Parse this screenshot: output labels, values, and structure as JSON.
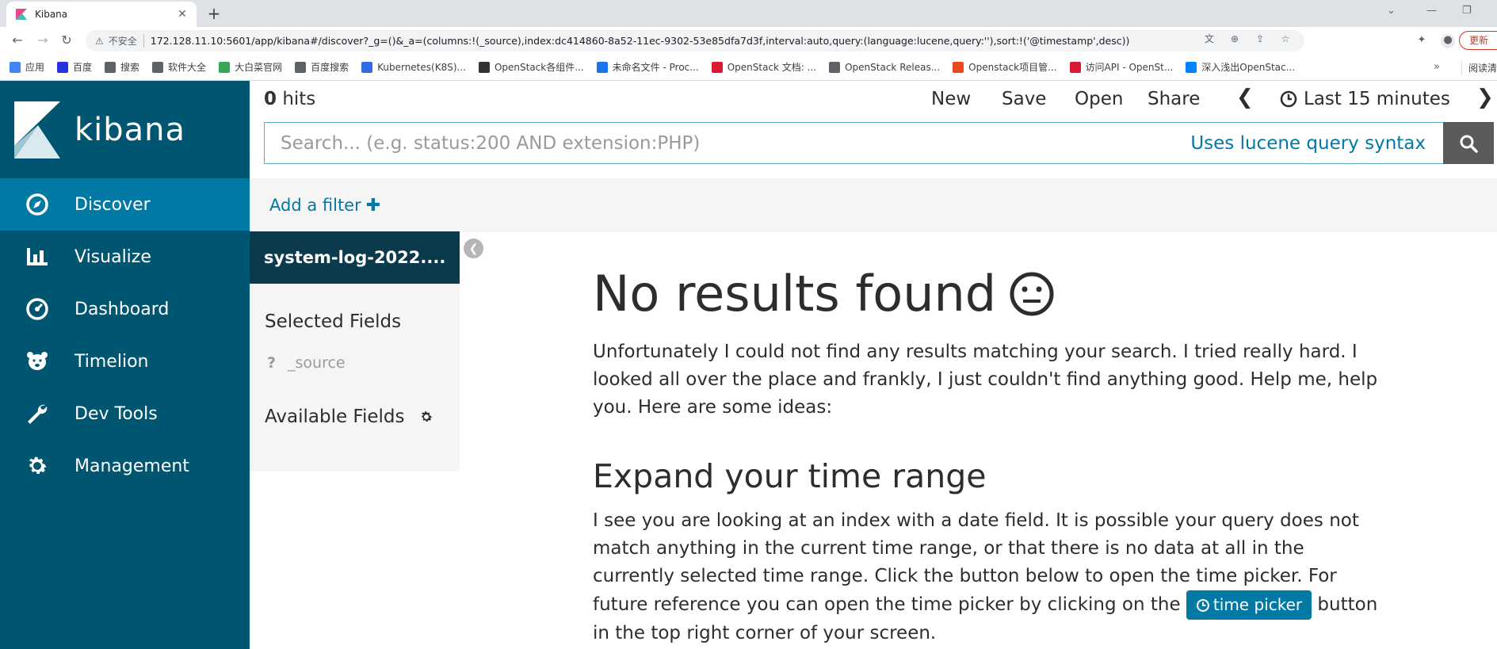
{
  "browser": {
    "tab_title": "Kibana",
    "insecure_label": "不安全",
    "url": "172.128.11.10:5601/app/kibana#/discover?_g=()&_a=(columns:!(_source),index:dc414860-8a52-11ec-9302-53e85dfa7d3f,interval:auto,query:(language:lucene,query:''),sort:!('@timestamp',desc))",
    "update_label": "更新",
    "bookmarks": [
      {
        "label": "应用",
        "icon": "apps-icon",
        "color": "#4285f4"
      },
      {
        "label": "百度",
        "icon": "baidu-icon",
        "color": "#2932e1"
      },
      {
        "label": "搜索",
        "icon": "globe-icon",
        "color": "#5f6368"
      },
      {
        "label": "软件大全",
        "icon": "globe-icon",
        "color": "#5f6368"
      },
      {
        "label": "大白菜官网",
        "icon": "leaf-icon",
        "color": "#34a853"
      },
      {
        "label": "百度搜索",
        "icon": "globe-icon",
        "color": "#5f6368"
      },
      {
        "label": "Kubernetes(K8S)...",
        "icon": "k8s-icon",
        "color": "#326ce5"
      },
      {
        "label": "OpenStack各组件...",
        "icon": "openstack-icon",
        "color": "#333333"
      },
      {
        "label": "未命名文件 - Proc...",
        "icon": "on-icon",
        "color": "#1a73e8"
      },
      {
        "label": "OpenStack 文档: ...",
        "icon": "openstack-red-icon",
        "color": "#da1a32"
      },
      {
        "label": "OpenStack Releas...",
        "icon": "globe-icon",
        "color": "#5f6368"
      },
      {
        "label": "Openstack项目管...",
        "icon": "c-icon",
        "color": "#e8491d"
      },
      {
        "label": "访问API - OpenSt...",
        "icon": "openstack-red-icon",
        "color": "#da1a32"
      },
      {
        "label": "深入浅出OpenStac...",
        "icon": "zhihu-icon",
        "color": "#0084ff"
      }
    ],
    "reading_list": "阅读清"
  },
  "kibana": {
    "logo": "kibana",
    "nav": [
      {
        "label": "Discover",
        "icon": "compass-icon",
        "active": true
      },
      {
        "label": "Visualize",
        "icon": "bar-chart-icon",
        "active": false
      },
      {
        "label": "Dashboard",
        "icon": "dashboard-icon",
        "active": false
      },
      {
        "label": "Timelion",
        "icon": "bear-icon",
        "active": false
      },
      {
        "label": "Dev Tools",
        "icon": "wrench-icon",
        "active": false
      },
      {
        "label": "Management",
        "icon": "gear-icon",
        "active": false
      }
    ],
    "hits_count": "0",
    "hits_label": " hits",
    "menu": {
      "new": "New",
      "save": "Save",
      "open": "Open",
      "share": "Share",
      "time_range": "Last 15 minutes"
    },
    "search": {
      "placeholder": "Search... (e.g. status:200 AND extension:PHP)",
      "syntax_link": "Uses lucene query syntax"
    },
    "add_filter": "Add a filter",
    "index_pattern": "system-log-2022....",
    "selected_fields_title": "Selected Fields",
    "selected_fields": [
      {
        "type": "?",
        "name": "_source"
      }
    ],
    "available_fields_title": "Available Fields",
    "no_results": {
      "title": "No results found",
      "emoji": "😐",
      "intro": "Unfortunately I could not find any results matching your search. I tried really hard. I looked all over the place and frankly, I just couldn't find anything good. Help me, help you. Here are some ideas:",
      "expand_title": "Expand your time range",
      "expand_text_1": "I see you are looking at an index with a date field. It is possible your query does not match anything in the current time range, or that there is no data at all in the currently selected time range. Click the button below to open the time picker. For future reference you can open the time picker by clicking on the ",
      "time_picker_label": "time picker",
      "expand_text_2": " button in the top right corner of your screen."
    }
  },
  "colors": {
    "sidebar": "#005571",
    "active_nav": "#0079a5",
    "index_header": "#0b3a4c",
    "link": "#0079a5"
  }
}
